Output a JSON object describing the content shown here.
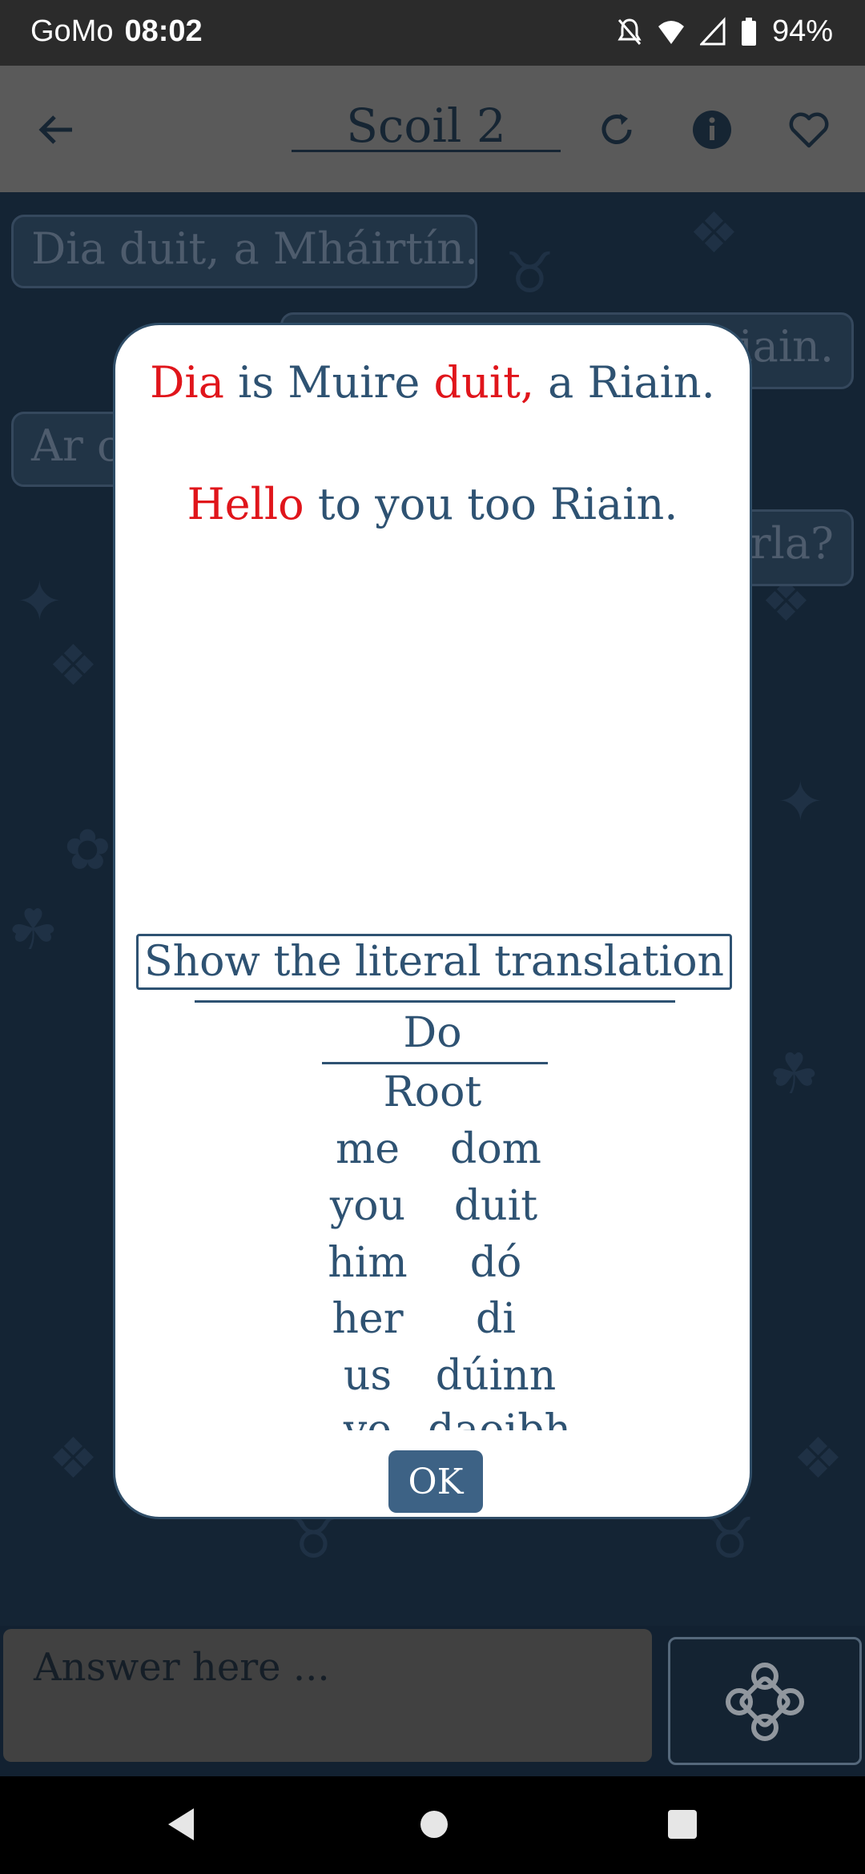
{
  "status_bar": {
    "carrier": "GoMo",
    "time": "08:02",
    "battery": "94%",
    "icons": [
      "bell-off-icon",
      "wifi-icon",
      "signal-icon",
      "battery-icon"
    ]
  },
  "toolbar": {
    "title": "Scoil 2",
    "icons": [
      "back-arrow-icon",
      "refresh-icon",
      "info-icon",
      "heart-icon"
    ]
  },
  "chat": {
    "bubbles": [
      {
        "text": "Dia duit, a Mháirtín."
      },
      {
        "text": "iain."
      },
      {
        "text": "Ar c"
      },
      {
        "text": "rla?"
      }
    ]
  },
  "modal": {
    "irish_parts": [
      {
        "text": "Dia",
        "highlight": true
      },
      {
        "text": " is Muire ",
        "highlight": false
      },
      {
        "text": "duit,",
        "highlight": true
      },
      {
        "text": " a Riain.",
        "highlight": false
      }
    ],
    "english_parts": [
      {
        "text": "Hello",
        "highlight": true
      },
      {
        "text": " to you too Riain.",
        "highlight": false
      }
    ],
    "show_literal_label": "Show the literal translation",
    "table_heading": "Do",
    "table_subheading": "Root",
    "rows": [
      {
        "english": "me",
        "irish": "dom"
      },
      {
        "english": "you",
        "irish": "duit"
      },
      {
        "english": "him",
        "irish": "dó"
      },
      {
        "english": "her",
        "irish": "di"
      },
      {
        "english": "us",
        "irish": "dúinn"
      },
      {
        "english": "ye",
        "irish": "daoibh"
      }
    ],
    "ok_label": "OK"
  },
  "answer_input": {
    "placeholder": "Answer here ..."
  },
  "colors": {
    "highlight": "#e0151b",
    "text": "#2e5272",
    "ok_button": "#3d6285"
  }
}
